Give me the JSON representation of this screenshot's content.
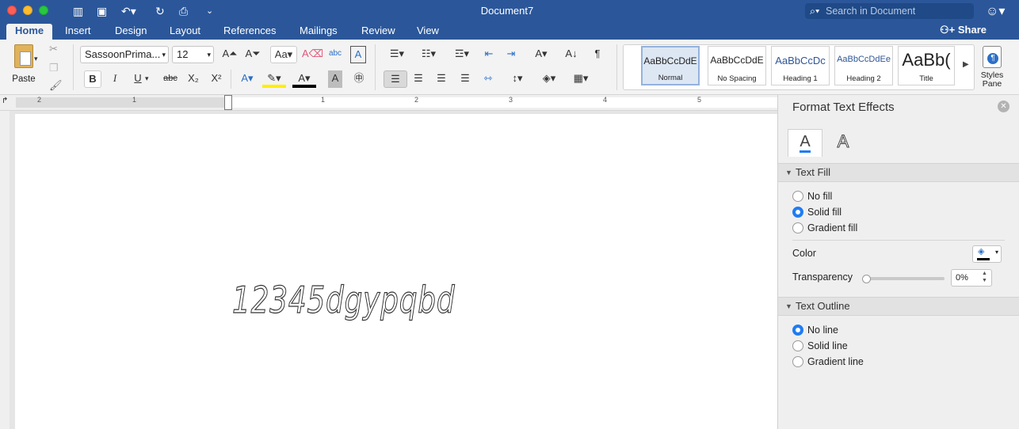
{
  "window": {
    "title": "Document7",
    "search_placeholder": "Search in Document"
  },
  "tabs": [
    "Home",
    "Insert",
    "Design",
    "Layout",
    "References",
    "Mailings",
    "Review",
    "View"
  ],
  "share_label": "Share",
  "ribbon": {
    "paste_label": "Paste",
    "font_name": "SassoonPrima...",
    "font_size": "12",
    "styles": [
      {
        "preview": "AaBbCcDdE",
        "name": "Normal"
      },
      {
        "preview": "AaBbCcDdE",
        "name": "No Spacing"
      },
      {
        "preview": "AaBbCcDc",
        "name": "Heading 1"
      },
      {
        "preview": "AaBbCcDdEe",
        "name": "Heading 2"
      },
      {
        "preview": "AaBb(",
        "name": "Title"
      }
    ],
    "styles_pane_label": "Styles Pane",
    "bold": "B",
    "italic": "I",
    "underline": "U",
    "strike": "abc"
  },
  "ruler_numbers": [
    "2",
    "1",
    "1",
    "1",
    "2",
    "3",
    "4",
    "5"
  ],
  "document": {
    "text": "12345dgypqbd"
  },
  "format_pane": {
    "title": "Format Text Effects",
    "text_fill_header": "Text Fill",
    "fill_options": [
      "No fill",
      "Solid fill",
      "Gradient fill"
    ],
    "fill_selected": "Solid fill",
    "color_label": "Color",
    "transparency_label": "Transparency",
    "transparency_value": "0%",
    "transparency_level": 0,
    "text_outline_header": "Text Outline",
    "outline_options": [
      "No line",
      "Solid line",
      "Gradient line"
    ],
    "outline_selected": "No line"
  },
  "colors": {
    "accent": "#2b579a",
    "radio_selected": "#1f7cf4"
  }
}
